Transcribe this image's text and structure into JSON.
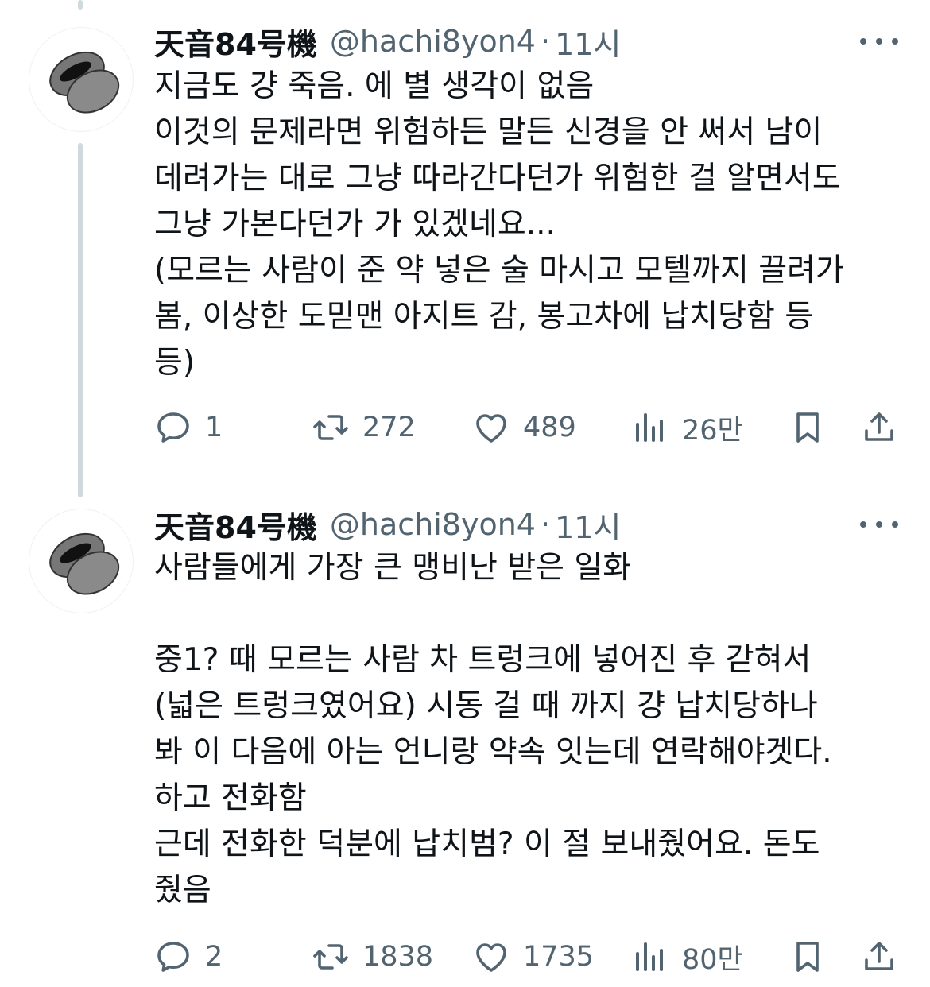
{
  "tweets": [
    {
      "name": "天音84号機",
      "handle": "@hachi8yon4",
      "separator": "·",
      "time": "11시",
      "lines": [
        "지금도 걍 죽음. 에 별 생각이 없음",
        "이것의 문제라면 위험하든 말든 신경을 안 써서 남이",
        "데려가는 대로 그냥 따라간다던가 위험한 걸 알면서도",
        "그냥 가본다던가 가 있겠네요...",
        "(모르는 사람이 준 약 넣은 술 마시고 모텔까지 끌려가",
        "봄, 이상한 도믿맨 아지트 감, 봉고차에 납치당함 등",
        "등)"
      ],
      "stats": {
        "replies": "1",
        "retweets": "272",
        "likes": "489",
        "views": "26만"
      }
    },
    {
      "name": "天音84号機",
      "handle": "@hachi8yon4",
      "separator": "·",
      "time": "11시",
      "lines": [
        "사람들에게 가장 큰 맹비난 받은 일화",
        "",
        "중1? 때 모르는 사람 차 트렁크에 넣어진 후 갇혀서",
        "(넓은 트렁크였어요) 시동 걸 때 까지 걍 납치당하나",
        "봐 이 다음에 아는 언니랑 약속 잇는데 연락해야겟다.",
        "하고 전화함",
        "근데 전화한 덕분에 납치범? 이 절 보내줬어요. 돈도",
        "줬음"
      ],
      "stats": {
        "replies": "2",
        "retweets": "1838",
        "likes": "1735",
        "views": "80만"
      }
    }
  ],
  "icons": {
    "reply": "reply-icon",
    "retweet": "retweet-icon",
    "like": "heart-icon",
    "views": "views-icon",
    "bookmark": "bookmark-icon",
    "share": "share-icon",
    "more": "more-icon"
  },
  "colors": {
    "text": "#0f1419",
    "secondary": "#536471",
    "thread_line": "#cfd9de"
  }
}
